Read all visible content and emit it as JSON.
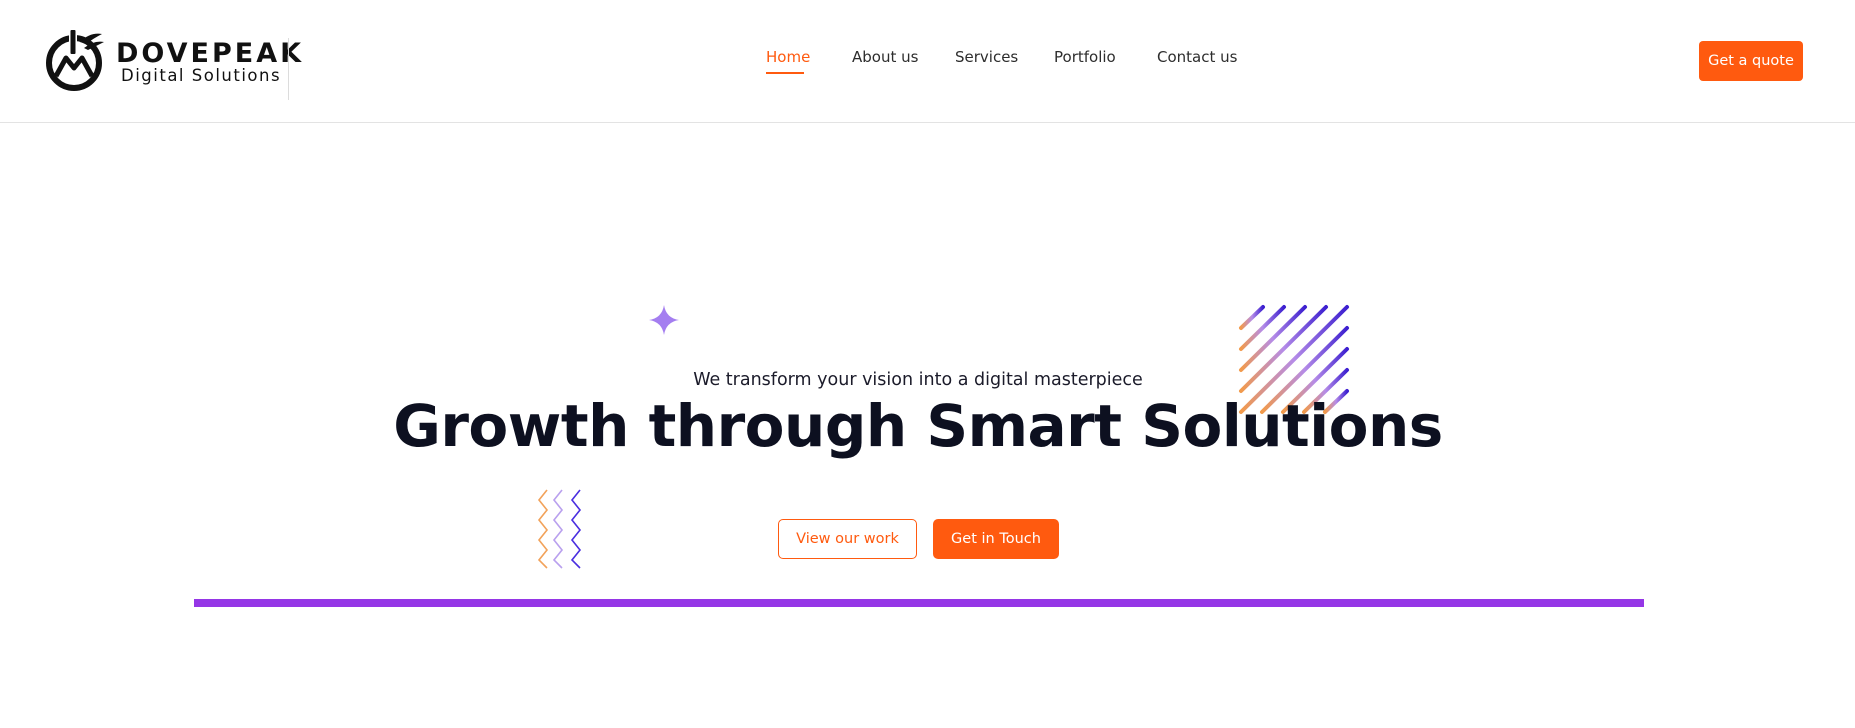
{
  "brand": {
    "name": "DOVEPEAK",
    "tagline": "Digital Solutions"
  },
  "nav": {
    "items": [
      {
        "label": "Home",
        "active": true
      },
      {
        "label": "About us",
        "active": false
      },
      {
        "label": "Services",
        "active": false
      },
      {
        "label": "Portfolio",
        "active": false
      },
      {
        "label": "Contact us",
        "active": false
      }
    ],
    "cta_label": "Get a quote"
  },
  "hero": {
    "subtitle": "We transform your vision into a digital masterpiece",
    "title": "Growth through Smart Solutions",
    "secondary_button": "View our work",
    "primary_button": "Get in Touch"
  },
  "icons": {
    "logo": "mountain-power-logo-icon",
    "sparkle": "sparkle-star-icon",
    "stripes": "diagonal-stripes-icon",
    "zigzag": "zigzag-lines-icon"
  },
  "colors": {
    "accent": "#ff5a0f",
    "purple": "#9536e6",
    "text_dark": "#0d1020"
  }
}
